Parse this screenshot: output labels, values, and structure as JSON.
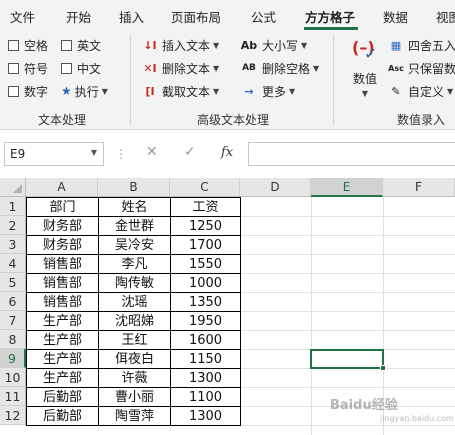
{
  "tabs": [
    "文件",
    "开始",
    "插入",
    "页面布局",
    "公式",
    "方方格子",
    "数据",
    "视图"
  ],
  "ribbon": {
    "text_processing": {
      "label": "文本处理",
      "checkboxes": [
        "空格",
        "英文",
        "符号",
        "中文",
        "数字"
      ],
      "execute": "执行"
    },
    "advanced_text": {
      "label": "高级文本处理",
      "insert_text": "插入文本",
      "delete_text": "删除文本",
      "extract_text": "截取文本",
      "case": "大小写",
      "delete_spaces": "删除空格",
      "more": "更多",
      "case_icon": "Ab",
      "spaces_icon": "AB"
    },
    "number_entry": {
      "label": "数值录入",
      "number": "数值",
      "round": "四舍五入",
      "keep_numbers": "只保留数",
      "custom": "自定义"
    }
  },
  "formula_bar": {
    "name_box": "E9",
    "fx": "fx",
    "cancel": "✕",
    "enter": "✓"
  },
  "sheet": {
    "columns": [
      "A",
      "B",
      "C",
      "D",
      "E",
      "F"
    ],
    "selected_column": "E",
    "selected_row": 9,
    "rows": [
      1,
      2,
      3,
      4,
      5,
      6,
      7,
      8,
      9,
      10,
      11,
      12
    ],
    "table": [
      [
        "部门",
        "姓名",
        "工资"
      ],
      [
        "财务部",
        "金世群",
        "1250"
      ],
      [
        "财务部",
        "吴冷安",
        "1700"
      ],
      [
        "销售部",
        "李凡",
        "1550"
      ],
      [
        "销售部",
        "陶传敏",
        "1000"
      ],
      [
        "销售部",
        "沈瑶",
        "1350"
      ],
      [
        "生产部",
        "沈昭娣",
        "1950"
      ],
      [
        "生产部",
        "王红",
        "1600"
      ],
      [
        "生产部",
        "佴夜白",
        "1150"
      ],
      [
        "生产部",
        "许薇",
        "1300"
      ],
      [
        "后勤部",
        "曹小丽",
        "1100"
      ],
      [
        "后勤部",
        "陶雪萍",
        "1300"
      ]
    ]
  },
  "watermark": {
    "text": "Baidu经验",
    "sub": "jingyan.baidu.com"
  },
  "colors": {
    "accent": "#217346",
    "ribbon_bg": "#f3f3f3",
    "icon_red": "#c42b1c",
    "icon_blue": "#2b6cc4"
  }
}
